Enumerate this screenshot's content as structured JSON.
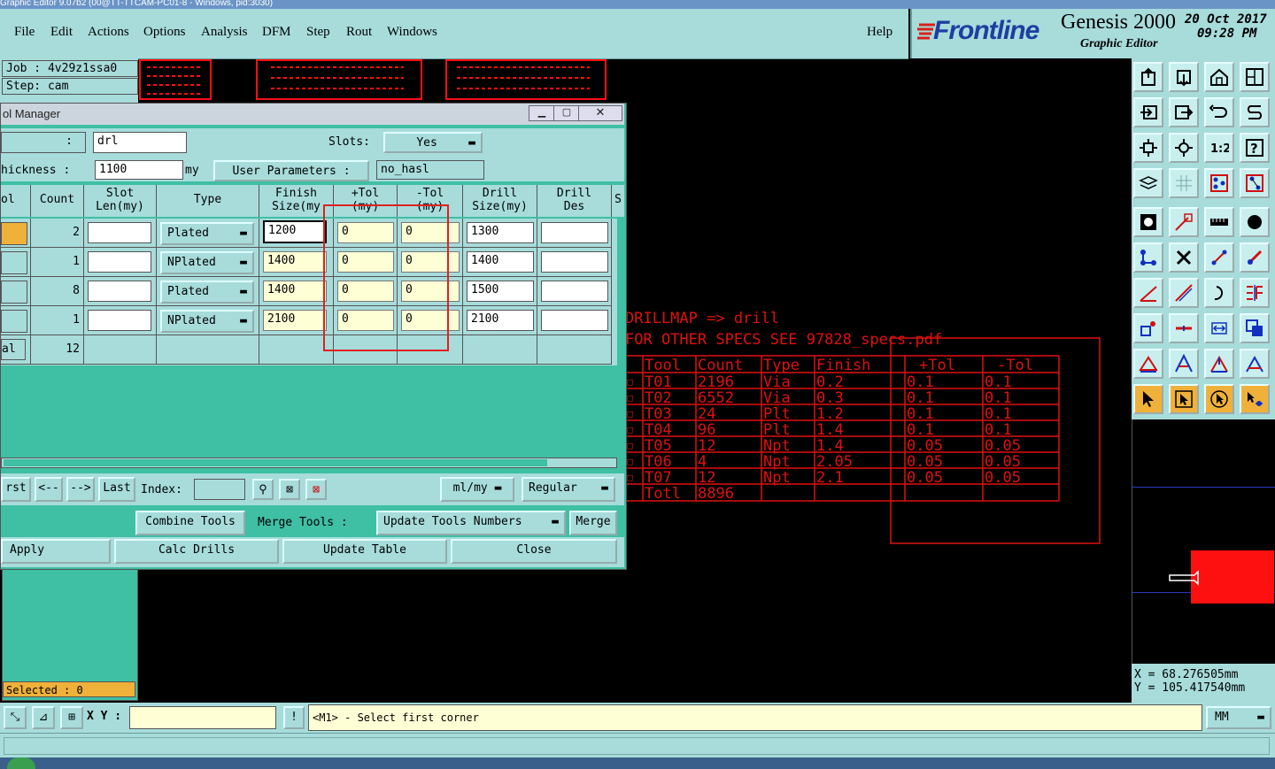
{
  "window_title": "Graphic Editor 9.07b2 (00@TT-TTCAM-PC01-8 - Windows, pid:3030)",
  "menubar": {
    "items": [
      {
        "label": "File"
      },
      {
        "label": "Edit"
      },
      {
        "label": "Actions"
      },
      {
        "label": "Options"
      },
      {
        "label": "Analysis"
      },
      {
        "label": "DFM"
      },
      {
        "label": "Step"
      },
      {
        "label": "Rout"
      },
      {
        "label": "Windows"
      }
    ],
    "help": "Help"
  },
  "brand": {
    "logo": "Frontline",
    "product": "Genesis 2000",
    "subtitle": "Graphic Editor",
    "date": "20 Oct 2017",
    "time": "09:28 PM"
  },
  "info": {
    "job": "Job : 4v29z1ssa0",
    "step": "Step: cam",
    "selected": "Selected : 0"
  },
  "dialog": {
    "title": "ol Manager",
    "name_label": ":",
    "name_value": "drl",
    "slots_label": "Slots:",
    "slots_value": "Yes",
    "thickness_label": "hickness :",
    "thickness_value": "1100",
    "thickness_unit": "my",
    "user_params_label": "User Parameters :",
    "user_params_value": "no_hasl",
    "headers": {
      "tool": "ol",
      "count": "Count",
      "slot_line1": "Slot",
      "slot_line2": "Len(my)",
      "type": "Type",
      "finish_line1": "Finish",
      "finish_line2": "Size(my",
      "ptol_line1": "+Tol",
      "ptol_line2": "(my)",
      "mtol_line1": "-Tol",
      "mtol_line2": "(my)",
      "drill_line1": "Drill",
      "drill_line2": "Size(my)",
      "des_line1": "Drill",
      "des_line2": "Des",
      "extra": "S"
    },
    "rows": [
      {
        "count": "2",
        "type": "Plated",
        "finish": "1200",
        "ptol": "0",
        "mtol": "0",
        "drill": "1300"
      },
      {
        "count": "1",
        "type": "NPlated",
        "finish": "1400",
        "ptol": "0",
        "mtol": "0",
        "drill": "1400"
      },
      {
        "count": "8",
        "type": "Plated",
        "finish": "1400",
        "ptol": "0",
        "mtol": "0",
        "drill": "1500"
      },
      {
        "count": "1",
        "type": "NPlated",
        "finish": "2100",
        "ptol": "0",
        "mtol": "0",
        "drill": "2100"
      }
    ],
    "total_label": "al",
    "total_count": "12",
    "nav": {
      "first": "rst",
      "prev": "<--",
      "next": "-->",
      "last": "Last",
      "index_label": "Index:",
      "units": "ml/my",
      "mode": "Regular"
    },
    "combine": "Combine Tools",
    "merge_label": "Merge Tools :",
    "update_numbers": "Update Tools Numbers",
    "merge": "Merge",
    "apply": "Apply",
    "calc": "Calc Drills",
    "update_table": "Update Table",
    "close": "Close"
  },
  "drillmap": {
    "line1": "DRILLMAP => drill",
    "line2": "FOR OTHER SPECS SEE 97828_specs.pdf",
    "headers": [
      "Tool",
      "Count",
      "Type",
      "Finish",
      "+Tol",
      "-Tol"
    ],
    "rows": [
      {
        "sym": "□",
        "tool": "T01",
        "count": "2196",
        "type": "Via",
        "finish": "0.2",
        "ptol": "0.1",
        "mtol": "0.1"
      },
      {
        "sym": "□",
        "tool": "T02",
        "count": "6552",
        "type": "Via",
        "finish": "0.3",
        "ptol": "0.1",
        "mtol": "0.1"
      },
      {
        "sym": "□",
        "tool": "T03",
        "count": "24",
        "type": "Plt",
        "finish": "1.2",
        "ptol": "0.1",
        "mtol": "0.1"
      },
      {
        "sym": "□",
        "tool": "T04",
        "count": "96",
        "type": "Plt",
        "finish": "1.4",
        "ptol": "0.1",
        "mtol": "0.1"
      },
      {
        "sym": "□",
        "tool": "T05",
        "count": "12",
        "type": "Npt",
        "finish": "1.4",
        "ptol": "0.05",
        "mtol": "0.05"
      },
      {
        "sym": "□",
        "tool": "T06",
        "count": "4",
        "type": "Npt",
        "finish": "2.05",
        "ptol": "0.05",
        "mtol": "0.05"
      },
      {
        "sym": "□",
        "tool": "T07",
        "count": "12",
        "type": "Npt",
        "finish": "2.1",
        "ptol": "0.05",
        "mtol": "0.05"
      }
    ],
    "total_label": "Totl",
    "total_count": "8896"
  },
  "coords": {
    "x": "X =  68.276505mm",
    "y": "Y = 105.417540mm"
  },
  "bottom": {
    "xy_label": "X Y :",
    "prompt": "<M1> - Select first corner",
    "units": "MM"
  },
  "colors": {
    "panel": "#a7dcdb",
    "dialog": "#3fbfa4",
    "drill_red": "#e01010",
    "highlight": "#f0b13a"
  }
}
